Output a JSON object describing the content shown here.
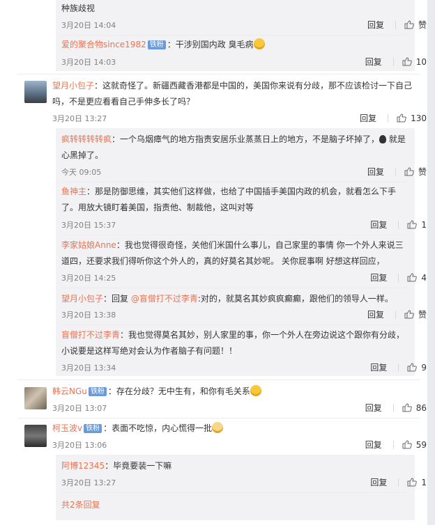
{
  "comments": {
    "c0": {
      "text": "种族歧视",
      "time": "3月20日 14:04",
      "reply": "回复",
      "like": "赞"
    },
    "c1": {
      "user": "爱的聚合物since1982",
      "badge": "铁粉",
      "text": "：干涉别国内政  臭毛病",
      "time": "3月20日 14:03",
      "reply": "回复",
      "like": "10"
    },
    "c2": {
      "user": "望月小包子",
      "text": "：这就奇怪了。新疆西藏香港都是中国的，美国你来说有分歧，那不应该检讨一下自己吗，不是更应看看自己手伸多长了吗？",
      "line1": "：这就奇怪了。新疆西藏香港都是中国的，美国你来说有分歧，那不应该检讨一下自己",
      "line2": "吗，不是更应看看自己手伸多长了吗？",
      "time": "3月20日 13:27",
      "reply": "回复",
      "like": "130"
    },
    "c3": {
      "user": "疯转转转转疯",
      "line1": "：一个乌烟瘴气的地方指责安居乐业蒸蒸日上的地方，不是脑子坏掉了，",
      "line1b": " 就是",
      "line2": "心黑掉了。",
      "time": "今天 09:05",
      "reply": "回复",
      "like": "赞"
    },
    "c4": {
      "user": "鱼神主",
      "line1": "：那是防御思维，其实他们这样做，也给了中国插手美国内政的机会，就看怎么下手",
      "line2": "了。用放大镜盯着美国，指责他、制裁他，这叫对等",
      "time": "3月20日 15:37",
      "reply": "回复",
      "like": "1"
    },
    "c5": {
      "user": "李家姑娘Anne",
      "line1": "：我也觉得很奇怪，关他们米国什么事儿，自己家里的事情 你一个外人来说三",
      "line2": "道四，还要求我们得听你这个外人的，真的好莫名其妙呢。 关你屁事啊  好想这样回应，",
      "time": "3月20日 14:25",
      "reply": "回复",
      "like": "4"
    },
    "c6": {
      "user": "望月小包子",
      "pre": "：回复 ",
      "mention": "@盲僧打不过李青",
      "text": ":对的，就莫名其妙疯疯癫癫，跟他们的领导人一样。",
      "time": "3月20日 13:38",
      "reply": "回复",
      "like": "赞"
    },
    "c7": {
      "user": "盲僧打不过李青",
      "line1": "：我也觉得莫名其妙，别人家里的事，你一个外人在旁边说这个跟你有分歧，",
      "line2": "小说要是这样写绝对会认为作者脑子有问题！！",
      "time": "3月20日 13:34",
      "reply": "回复",
      "like": "9"
    },
    "c8": {
      "user": "韩云NGu",
      "badge": "铁粉",
      "text": "：存在分歧？无中生有，和你有毛关系",
      "time": "3月20日 13:07",
      "reply": "回复",
      "like": "86"
    },
    "c9": {
      "user": "柯玉波v",
      "badge": "铁粉",
      "text": "：表面不吃惊，内心慌得一批",
      "time": "3月20日 13:06",
      "reply": "回复",
      "like": "59"
    },
    "c10": {
      "user": "阿博12345",
      "text": "：毕竟要装一下嘛",
      "time": "3月20日 13:27",
      "reply": "回复",
      "like": "1"
    }
  },
  "more_replies": "共2条回复",
  "colors": {
    "username": "#eb7350",
    "badge": "#6a9bd8",
    "subbg": "#f2f2f5"
  }
}
